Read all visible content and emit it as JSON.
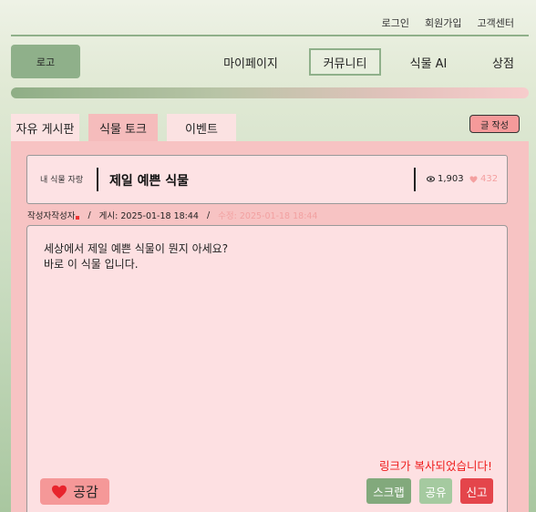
{
  "header": {
    "links": [
      {
        "label": "로그인",
        "name": "login-link"
      },
      {
        "label": "회원가입",
        "name": "signup-link"
      },
      {
        "label": "고객센터",
        "name": "support-link"
      }
    ],
    "logo": "로고",
    "nav": [
      "마이페이지",
      "커뮤니티",
      "식물 AI",
      "상점"
    ],
    "active_nav": "커뮤니티"
  },
  "board": {
    "tabs": [
      "자유 게시판",
      "식물 토크",
      "이벤트"
    ],
    "active_tab": "식물 토크",
    "write_label": "글 작성"
  },
  "post": {
    "category": "내 식물 자랑",
    "title": "제일 예쁜 식물",
    "views": "1,903",
    "likes": "432",
    "author": "작성자작성자",
    "separator": "/",
    "posted": "게시: 2025-01-18 18:44",
    "modified": "수정: 2025-01-18 18:44",
    "content": [
      "세상에서 제일 예쁜 식물이 뭔지 아세요?",
      "바로 이 식물 입니다."
    ]
  },
  "actions": {
    "copied_message": "링크가 복사되었습니다!",
    "like_label": "공감",
    "scrap_label": "스크랩",
    "share_label": "공유",
    "report_label": "신고"
  },
  "colors": {
    "accent_green": "#8fb08a",
    "accent_pink": "#f7c3c3",
    "report_red": "#e4454b",
    "alert_red": "#ee1c1c"
  },
  "icons": {
    "views": "eye-icon",
    "likes": "heart-icon",
    "like_button": "heart-icon"
  }
}
